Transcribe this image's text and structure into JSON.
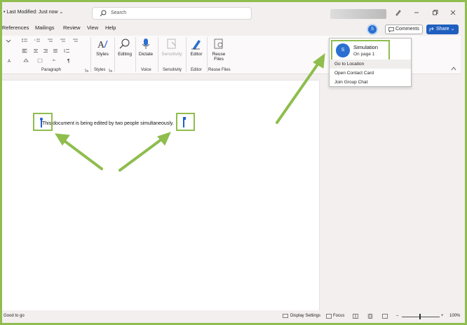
{
  "titlebar": {
    "last_modified": "• Last Modified: Just now ⌄",
    "search_placeholder": "Search"
  },
  "tabs": [
    "References",
    "Mailings",
    "Review",
    "View",
    "Help"
  ],
  "header_buttons": {
    "collaborator_initial": "S",
    "comments": "Comments",
    "share": "Share ⌄"
  },
  "ribbon": {
    "styles": "Styles",
    "editing": "Editing",
    "dictate": "Dictate",
    "sensitivity": "Sensitivity",
    "editor": "Editor",
    "reuse_files_1": "Reuse",
    "reuse_files_2": "Files",
    "groups": {
      "paragraph": "Paragraph",
      "styles": "Styles",
      "voice": "Voice",
      "sensitivity": "Sensitivity",
      "editor": "Editor",
      "reuse_files": "Reuse Files"
    }
  },
  "document": {
    "text": "This document is being edited by two people simultaneously."
  },
  "contact_card": {
    "initial": "S",
    "name": "Simulation",
    "location": "On page 1",
    "items": [
      "Go to Location",
      "Open Contact Card",
      "Join Group Chat"
    ]
  },
  "statusbar": {
    "accessibility": "Good to go",
    "display_settings": "Display Settings",
    "focus": "Focus",
    "zoom": "100%"
  },
  "colors": {
    "highlight": "#8fbd4e",
    "accent": "#1f5fbf"
  }
}
